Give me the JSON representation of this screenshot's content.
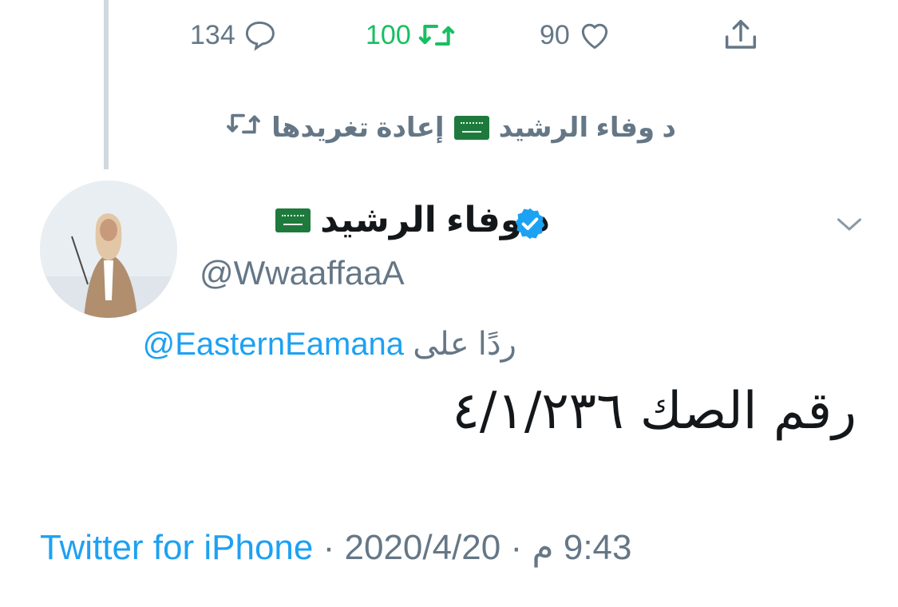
{
  "actions": {
    "reply_count": "134",
    "retweet_count": "100",
    "like_count": "90"
  },
  "retweet_context": {
    "name": "د وفاء الرشيد",
    "label": "إعادة تغريدها"
  },
  "tweet": {
    "display_name": "د وفاء الرشيد",
    "handle": "@WwaaffaaA",
    "reply_prefix": "ردًا على",
    "reply_to": "@EasternEamana",
    "text": "رقم الصك ٤/١/٢٣٦",
    "time": "9:43 م",
    "date": "2020/4/20",
    "separator": "·",
    "source": "Twitter for iPhone"
  },
  "colors": {
    "accent": "#1da1f2",
    "retweet_active": "#17bf63",
    "muted": "#657786",
    "verified": "#1da1f2"
  },
  "icons": [
    "reply-icon",
    "retweet-icon",
    "like-icon",
    "share-icon",
    "chevron-down-icon",
    "verified-icon",
    "saudi-flag-icon"
  ]
}
